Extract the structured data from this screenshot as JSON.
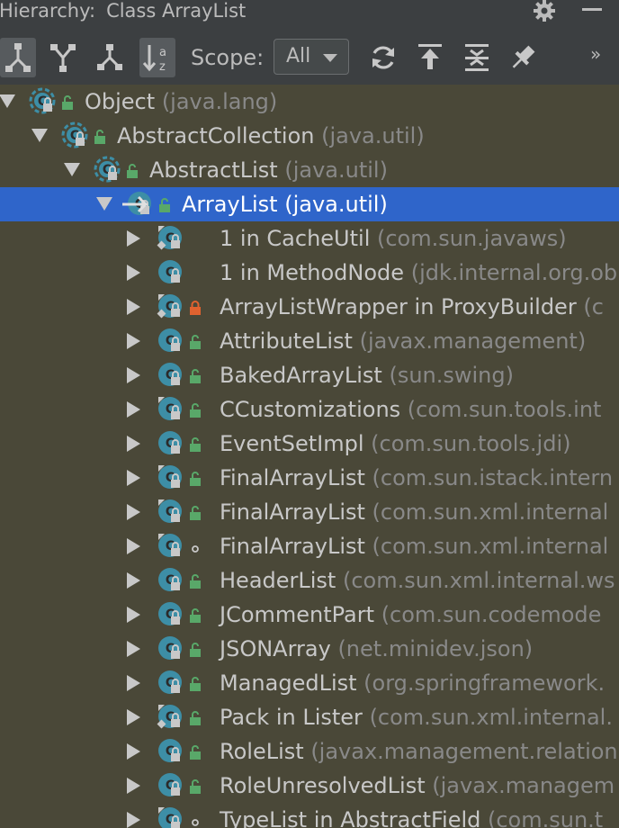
{
  "window": {
    "title_prefix": "Hierarchy:",
    "title": "Class ArrayList"
  },
  "toolbar": {
    "scope_label": "Scope:",
    "scope_value": "All",
    "more_label": "»"
  },
  "colors": {
    "panel_bg": "#3c3f41",
    "tree_bg": "#4a4838",
    "selection": "#2f65ca",
    "class_icon": "#3d8ea6",
    "public_access": "#59a869",
    "private_access": "#e0622f"
  },
  "tree": [
    {
      "name": "Object",
      "pkg": "(java.lang)",
      "expanded": true,
      "access": "public",
      "icon": "abstract",
      "arrow": "down"
    },
    {
      "name": "AbstractCollection",
      "pkg": "(java.util)",
      "expanded": true,
      "access": "public",
      "icon": "abstract",
      "arrow": "down"
    },
    {
      "name": "AbstractList",
      "pkg": "(java.util)",
      "expanded": true,
      "access": "public",
      "icon": "abstract",
      "arrow": "down"
    },
    {
      "name": "ArrayList",
      "pkg": "(java.util)",
      "expanded": true,
      "access": "public",
      "icon": "current",
      "arrow": "down",
      "selected": true
    },
    {
      "name": "1 in CacheUtil",
      "pkg": "(com.sun.javaws)",
      "access": "none",
      "icon": "anon",
      "arrow": "right"
    },
    {
      "name": "1 in MethodNode",
      "pkg": "(jdk.internal.org.ob",
      "access": "none",
      "icon": "plain",
      "arrow": "right"
    },
    {
      "name": "ArrayListWrapper in ProxyBuilder",
      "pkg": "(c",
      "access": "private",
      "icon": "anon",
      "arrow": "right"
    },
    {
      "name": "AttributeList",
      "pkg": "(javax.management)",
      "access": "public",
      "icon": "plain",
      "arrow": "right"
    },
    {
      "name": "BakedArrayList",
      "pkg": "(sun.swing)",
      "access": "public",
      "icon": "plain",
      "arrow": "right"
    },
    {
      "name": "CCustomizations",
      "pkg": "(com.sun.tools.int",
      "access": "public",
      "icon": "final",
      "arrow": "right"
    },
    {
      "name": "EventSetImpl",
      "pkg": "(com.sun.tools.jdi)",
      "access": "public",
      "icon": "plain",
      "arrow": "right"
    },
    {
      "name": "FinalArrayList",
      "pkg": "(com.sun.istack.intern",
      "access": "public",
      "icon": "final",
      "arrow": "right"
    },
    {
      "name": "FinalArrayList",
      "pkg": "(com.sun.xml.internal",
      "access": "public",
      "icon": "final",
      "arrow": "right"
    },
    {
      "name": "FinalArrayList",
      "pkg": "(com.sun.xml.internal",
      "access": "package",
      "icon": "final",
      "arrow": "right"
    },
    {
      "name": "HeaderList",
      "pkg": "(com.sun.xml.internal.ws",
      "access": "public",
      "icon": "plain",
      "arrow": "right"
    },
    {
      "name": "JCommentPart",
      "pkg": "(com.sun.codemode",
      "access": "public",
      "icon": "plain",
      "arrow": "right"
    },
    {
      "name": "JSONArray",
      "pkg": "(net.minidev.json)",
      "access": "public",
      "icon": "plain",
      "arrow": "right"
    },
    {
      "name": "ManagedList",
      "pkg": "(org.springframework.",
      "access": "public",
      "icon": "plain",
      "arrow": "right"
    },
    {
      "name": "Pack in Lister",
      "pkg": "(com.sun.xml.internal.",
      "access": "public",
      "icon": "anon",
      "arrow": "right"
    },
    {
      "name": "RoleList",
      "pkg": "(javax.management.relation",
      "access": "public",
      "icon": "plain",
      "arrow": "right"
    },
    {
      "name": "RoleUnresolvedList",
      "pkg": "(javax.managem",
      "access": "public",
      "icon": "plain",
      "arrow": "right"
    },
    {
      "name": "TypeList in AbstractField",
      "pkg": "(com.sun.t",
      "access": "package",
      "icon": "final",
      "arrow": "right"
    }
  ]
}
